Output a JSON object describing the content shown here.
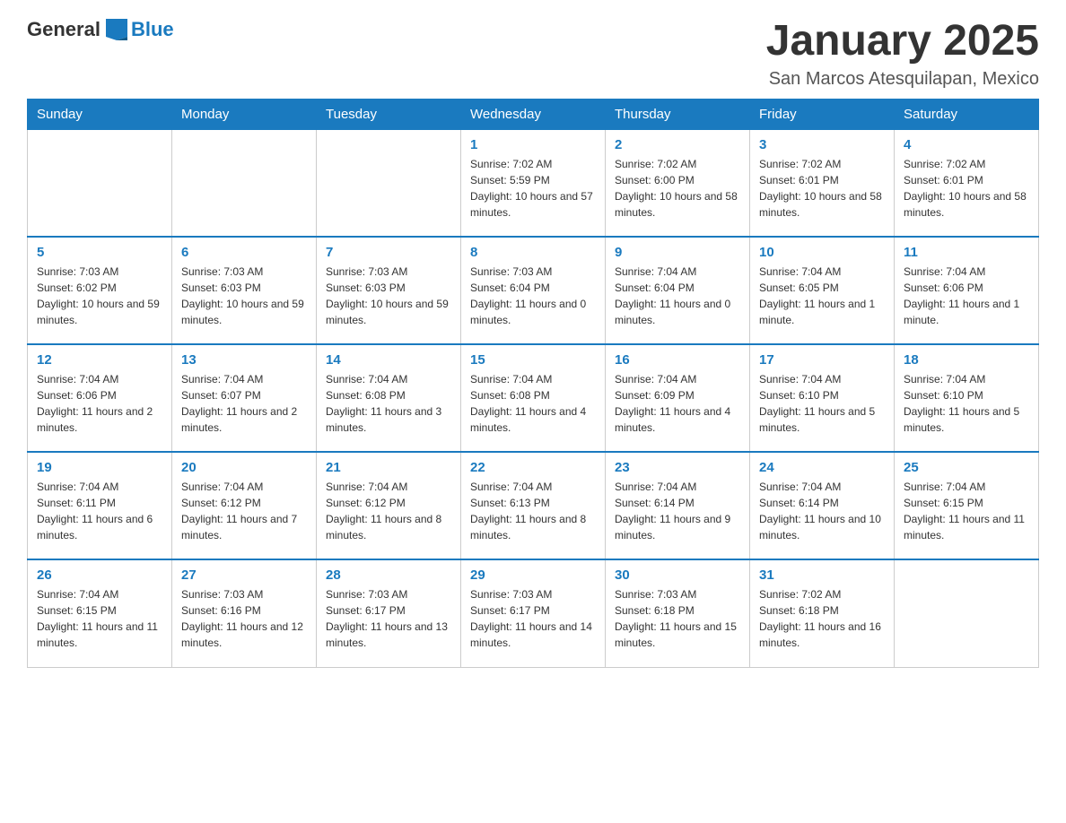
{
  "logo": {
    "general": "General",
    "blue": "Blue"
  },
  "title": "January 2025",
  "location": "San Marcos Atesquilapan, Mexico",
  "days_of_week": [
    "Sunday",
    "Monday",
    "Tuesday",
    "Wednesday",
    "Thursday",
    "Friday",
    "Saturday"
  ],
  "weeks": [
    [
      null,
      null,
      null,
      {
        "day": 1,
        "sunrise": "7:02 AM",
        "sunset": "5:59 PM",
        "daylight": "10 hours and 57 minutes."
      },
      {
        "day": 2,
        "sunrise": "7:02 AM",
        "sunset": "6:00 PM",
        "daylight": "10 hours and 58 minutes."
      },
      {
        "day": 3,
        "sunrise": "7:02 AM",
        "sunset": "6:01 PM",
        "daylight": "10 hours and 58 minutes."
      },
      {
        "day": 4,
        "sunrise": "7:02 AM",
        "sunset": "6:01 PM",
        "daylight": "10 hours and 58 minutes."
      }
    ],
    [
      {
        "day": 5,
        "sunrise": "7:03 AM",
        "sunset": "6:02 PM",
        "daylight": "10 hours and 59 minutes."
      },
      {
        "day": 6,
        "sunrise": "7:03 AM",
        "sunset": "6:03 PM",
        "daylight": "10 hours and 59 minutes."
      },
      {
        "day": 7,
        "sunrise": "7:03 AM",
        "sunset": "6:03 PM",
        "daylight": "10 hours and 59 minutes."
      },
      {
        "day": 8,
        "sunrise": "7:03 AM",
        "sunset": "6:04 PM",
        "daylight": "11 hours and 0 minutes."
      },
      {
        "day": 9,
        "sunrise": "7:04 AM",
        "sunset": "6:04 PM",
        "daylight": "11 hours and 0 minutes."
      },
      {
        "day": 10,
        "sunrise": "7:04 AM",
        "sunset": "6:05 PM",
        "daylight": "11 hours and 1 minute."
      },
      {
        "day": 11,
        "sunrise": "7:04 AM",
        "sunset": "6:06 PM",
        "daylight": "11 hours and 1 minute."
      }
    ],
    [
      {
        "day": 12,
        "sunrise": "7:04 AM",
        "sunset": "6:06 PM",
        "daylight": "11 hours and 2 minutes."
      },
      {
        "day": 13,
        "sunrise": "7:04 AM",
        "sunset": "6:07 PM",
        "daylight": "11 hours and 2 minutes."
      },
      {
        "day": 14,
        "sunrise": "7:04 AM",
        "sunset": "6:08 PM",
        "daylight": "11 hours and 3 minutes."
      },
      {
        "day": 15,
        "sunrise": "7:04 AM",
        "sunset": "6:08 PM",
        "daylight": "11 hours and 4 minutes."
      },
      {
        "day": 16,
        "sunrise": "7:04 AM",
        "sunset": "6:09 PM",
        "daylight": "11 hours and 4 minutes."
      },
      {
        "day": 17,
        "sunrise": "7:04 AM",
        "sunset": "6:10 PM",
        "daylight": "11 hours and 5 minutes."
      },
      {
        "day": 18,
        "sunrise": "7:04 AM",
        "sunset": "6:10 PM",
        "daylight": "11 hours and 5 minutes."
      }
    ],
    [
      {
        "day": 19,
        "sunrise": "7:04 AM",
        "sunset": "6:11 PM",
        "daylight": "11 hours and 6 minutes."
      },
      {
        "day": 20,
        "sunrise": "7:04 AM",
        "sunset": "6:12 PM",
        "daylight": "11 hours and 7 minutes."
      },
      {
        "day": 21,
        "sunrise": "7:04 AM",
        "sunset": "6:12 PM",
        "daylight": "11 hours and 8 minutes."
      },
      {
        "day": 22,
        "sunrise": "7:04 AM",
        "sunset": "6:13 PM",
        "daylight": "11 hours and 8 minutes."
      },
      {
        "day": 23,
        "sunrise": "7:04 AM",
        "sunset": "6:14 PM",
        "daylight": "11 hours and 9 minutes."
      },
      {
        "day": 24,
        "sunrise": "7:04 AM",
        "sunset": "6:14 PM",
        "daylight": "11 hours and 10 minutes."
      },
      {
        "day": 25,
        "sunrise": "7:04 AM",
        "sunset": "6:15 PM",
        "daylight": "11 hours and 11 minutes."
      }
    ],
    [
      {
        "day": 26,
        "sunrise": "7:04 AM",
        "sunset": "6:15 PM",
        "daylight": "11 hours and 11 minutes."
      },
      {
        "day": 27,
        "sunrise": "7:03 AM",
        "sunset": "6:16 PM",
        "daylight": "11 hours and 12 minutes."
      },
      {
        "day": 28,
        "sunrise": "7:03 AM",
        "sunset": "6:17 PM",
        "daylight": "11 hours and 13 minutes."
      },
      {
        "day": 29,
        "sunrise": "7:03 AM",
        "sunset": "6:17 PM",
        "daylight": "11 hours and 14 minutes."
      },
      {
        "day": 30,
        "sunrise": "7:03 AM",
        "sunset": "6:18 PM",
        "daylight": "11 hours and 15 minutes."
      },
      {
        "day": 31,
        "sunrise": "7:02 AM",
        "sunset": "6:18 PM",
        "daylight": "11 hours and 16 minutes."
      },
      null
    ]
  ]
}
